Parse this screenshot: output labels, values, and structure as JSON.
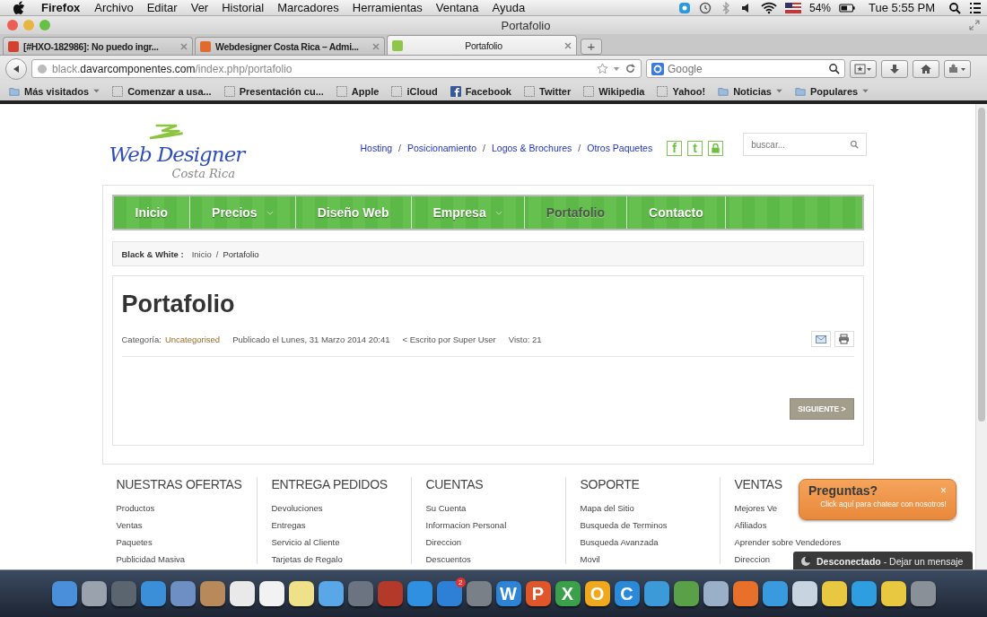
{
  "menu_bar": {
    "app": "Firefox",
    "items": [
      "Archivo",
      "Editar",
      "Ver",
      "Historial",
      "Marcadores",
      "Herramientas",
      "Ventana",
      "Ayuda"
    ],
    "battery": "54%",
    "clock": "Tue 5:55 PM"
  },
  "window": {
    "title": "Portafolio"
  },
  "tabs": [
    {
      "label": "[#HXO-182986]: No puedo ingr...",
      "selected": false,
      "color": "#d4402f"
    },
    {
      "label": "Webdesigner Costa Rica – Admi...",
      "selected": false,
      "color": "#e06b2c"
    },
    {
      "label": "Portafolio",
      "selected": true,
      "color": "#8fc64a"
    }
  ],
  "new_tab": "+",
  "address_bar": {
    "prefix": "black.",
    "domain": "davarcomponentes.com",
    "path": "/index.php/portafolio"
  },
  "search": {
    "placeholder": "Google"
  },
  "bookmarks": [
    {
      "kind": "folder",
      "label": "Más visitados",
      "dropdown": true
    },
    {
      "kind": "page",
      "label": "Comenzar a usa...",
      "dropdown": false
    },
    {
      "kind": "page",
      "label": "Presentación cu...",
      "dropdown": false
    },
    {
      "kind": "page",
      "label": "Apple",
      "dropdown": false
    },
    {
      "kind": "page",
      "label": "iCloud",
      "dropdown": false
    },
    {
      "kind": "facebook",
      "label": "Facebook",
      "dropdown": false
    },
    {
      "kind": "page",
      "label": "Twitter",
      "dropdown": false
    },
    {
      "kind": "page",
      "label": "Wikipedia",
      "dropdown": false
    },
    {
      "kind": "page",
      "label": "Yahoo!",
      "dropdown": false
    },
    {
      "kind": "folder",
      "label": "Noticias",
      "dropdown": true
    },
    {
      "kind": "folder",
      "label": "Populares",
      "dropdown": true
    }
  ],
  "site": {
    "logo": {
      "title": "Web Designer",
      "subtitle": "Costa Rica"
    },
    "top_links": [
      "Hosting",
      "Posicionamiento",
      "Logos & Brochures",
      "Otros Paquetes"
    ],
    "separator": "/",
    "social": [
      {
        "kind": "letter",
        "glyph": "f"
      },
      {
        "kind": "letter",
        "glyph": "t"
      },
      {
        "kind": "lock"
      }
    ],
    "search": {
      "placeholder": "buscar..."
    },
    "nav": [
      {
        "label": "Inicio",
        "selected": false,
        "dropdown": false
      },
      {
        "label": "Precios",
        "selected": false,
        "dropdown": true
      },
      {
        "label": "Diseño Web",
        "selected": false,
        "dropdown": false
      },
      {
        "label": "Empresa",
        "selected": false,
        "dropdown": true
      },
      {
        "label": "Portafolio",
        "selected": true,
        "dropdown": false
      },
      {
        "label": "Contacto",
        "selected": false,
        "dropdown": false
      }
    ],
    "breadcrumb": {
      "label": "Black & White :",
      "items": [
        "Inicio",
        "Portafolio"
      ],
      "separator": "/"
    },
    "article": {
      "title": "Portafolio",
      "category_label": "Categoría:",
      "category": "Uncategorised",
      "published": "Publicado el Lunes, 31 Marzo 2014 20:41",
      "author": "< Escrito por Super User",
      "views": "Visto: 21",
      "next_button": "SIGUIENTE >"
    },
    "footer": [
      {
        "heading": "NUESTRAS OFERTAS",
        "links": [
          "Productos",
          "Ventas",
          "Paquetes",
          "Publicidad Masiva"
        ]
      },
      {
        "heading": "ENTREGA PEDIDOS",
        "links": [
          "Devoluciones",
          "Entregas",
          "Servicio al Cliente",
          "Tarjetas de Regalo"
        ]
      },
      {
        "heading": "CUENTAS",
        "links": [
          "Su Cuenta",
          "Informacion Personal",
          "Direccion",
          "Descuentos"
        ]
      },
      {
        "heading": "SOPORTE",
        "links": [
          "Mapa del Sitio",
          "Busqueda de Terminos",
          "Busqueda Avanzada",
          "Movil"
        ]
      },
      {
        "heading": "VENTAS",
        "links": [
          "Mejores Ve",
          "Afiliados",
          "Aprender sobre Vendedores",
          "Direccion"
        ]
      }
    ],
    "chat": {
      "title": "Preguntas?",
      "close": "×",
      "subtitle": "Click aquí para chatear con nosotros!",
      "status": "Desconectado",
      "action": " - Dejar un mensaje"
    }
  },
  "dock": [
    {
      "color": "#4a8fd9"
    },
    {
      "color": "#9aa3ad"
    },
    {
      "color": "#5b6570"
    },
    {
      "color": "#3b8fd8"
    },
    {
      "color": "#6d8fc4"
    },
    {
      "color": "#b8895a"
    },
    {
      "color": "#e9e9e9"
    },
    {
      "color": "#f2f2f2"
    },
    {
      "color": "#efe08a"
    },
    {
      "color": "#5aa7e8"
    },
    {
      "color": "#6b7480"
    },
    {
      "color": "#b33a2b"
    },
    {
      "color": "#2f8fe0"
    },
    {
      "color": "#2e7fd6",
      "badge": "2"
    },
    {
      "color": "#7a8088"
    },
    {
      "color": "#2d84d6",
      "glyph": "W"
    },
    {
      "color": "#e0552a",
      "glyph": "P"
    },
    {
      "color": "#3aa04a",
      "glyph": "X"
    },
    {
      "color": "#f0a81c",
      "glyph": "O"
    },
    {
      "color": "#2a8ad8",
      "glyph": "C"
    },
    {
      "color": "#3d9ad8"
    },
    {
      "color": "#5aa048"
    },
    {
      "color": "#9ab0c8"
    },
    {
      "color": "#e8702a"
    },
    {
      "color": "#3a9ae0"
    },
    {
      "color": "#c8d4e0"
    },
    {
      "color": "#e8c840"
    },
    {
      "color": "#2f9ee0"
    },
    {
      "color": "#e8c840"
    },
    {
      "color": "#8a9098"
    }
  ]
}
